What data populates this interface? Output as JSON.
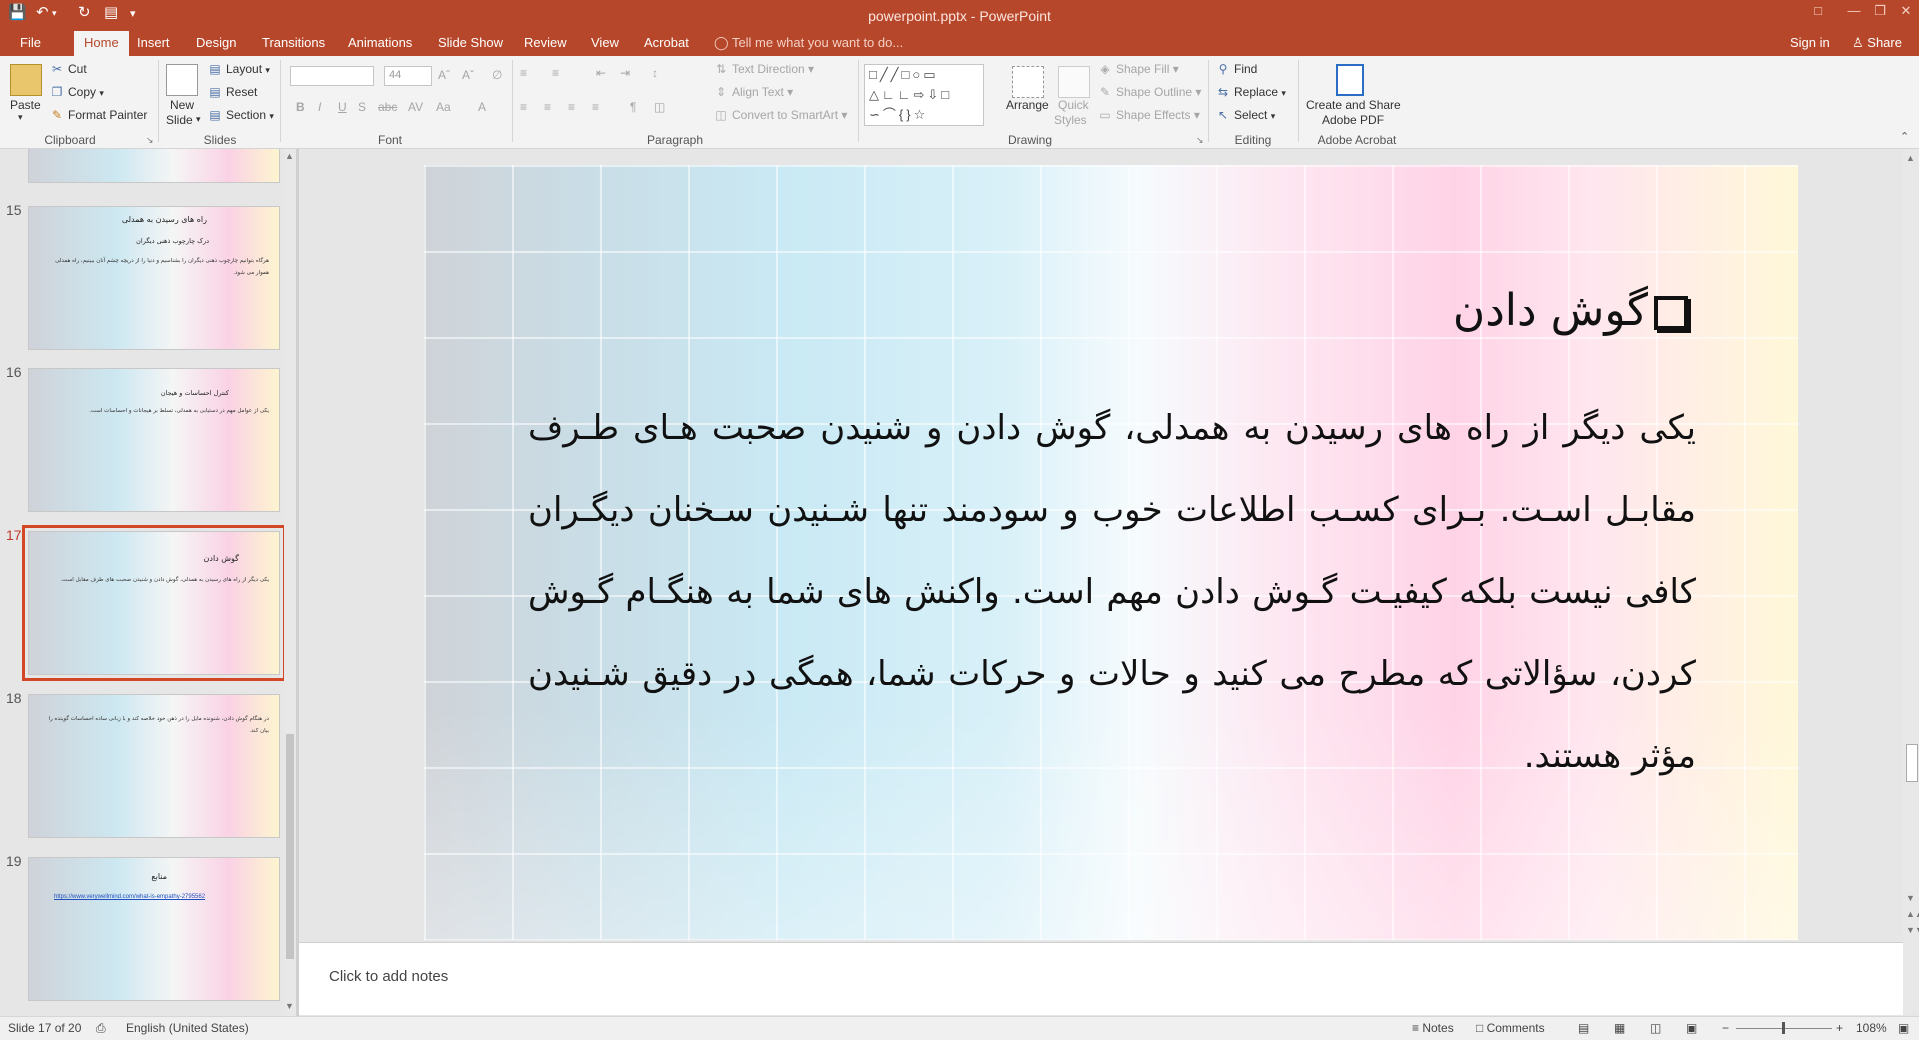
{
  "window": {
    "title": "powerpoint.pptx - PowerPoint"
  },
  "tabs": [
    {
      "label": "File"
    },
    {
      "label": "Home",
      "active": true
    },
    {
      "label": "Insert"
    },
    {
      "label": "Design"
    },
    {
      "label": "Transitions"
    },
    {
      "label": "Animations"
    },
    {
      "label": "Slide Show"
    },
    {
      "label": "Review"
    },
    {
      "label": "View"
    },
    {
      "label": "Acrobat"
    }
  ],
  "tell_me": "Tell me what you want to do...",
  "account": {
    "sign_in": "Sign in",
    "share": "Share"
  },
  "ribbon": {
    "clipboard": {
      "paste": "Paste",
      "cut": "Cut",
      "copy": "Copy",
      "format_painter": "Format Painter",
      "group": "Clipboard"
    },
    "slides": {
      "new_slide_1": "New",
      "new_slide_2": "Slide",
      "layout": "Layout",
      "reset": "Reset",
      "section": "Section",
      "group": "Slides"
    },
    "font": {
      "font_size": "44",
      "group": "Font"
    },
    "paragraph": {
      "text_direction": "Text Direction",
      "align_text": "Align Text",
      "convert_smartart": "Convert to SmartArt",
      "group": "Paragraph"
    },
    "drawing": {
      "arrange": "Arrange",
      "quick_styles_1": "Quick",
      "quick_styles_2": "Styles",
      "shape_fill": "Shape Fill",
      "shape_outline": "Shape Outline",
      "shape_effects": "Shape Effects",
      "group": "Drawing"
    },
    "editing": {
      "find": "Find",
      "replace": "Replace",
      "select": "Select",
      "group": "Editing"
    },
    "acrobat": {
      "create_share_1": "Create and Share",
      "create_share_2": "Adobe PDF",
      "group": "Adobe Acrobat"
    }
  },
  "thumbnails": [
    {
      "num": "15",
      "title": "راه های رسیدن به همدلی",
      "sub": "درک چارچوب ذهنی دیگران",
      "body": "هرگاه بتوانیم چارچوب ذهنی دیگران را بشناسیم و دنیا را از دریچه چشم آنان ببینیم، راه همدلی هموار می شود."
    },
    {
      "num": "16",
      "title": "",
      "sub": "کنترل احساسات و هیجان",
      "body": "یکی از عوامل مهم در دستیابی به همدلی، تسلط بر هیجانات و احساسات است."
    },
    {
      "num": "17",
      "title": "گوش دادن",
      "sub": "",
      "body": "یکی دیگر از راه های رسیدن به همدلی، گوش دادن و شنیدن صحبت های طرف مقابل است.",
      "selected": true
    },
    {
      "num": "18",
      "title": "",
      "sub": "",
      "body": "در هنگام گوش دادن، شنونده مایل را در ذهن خود خلاصه کند و با زبانی ساده احساسات گوینده را بیان کند."
    },
    {
      "num": "19",
      "title": "منابع",
      "sub": "",
      "body": "",
      "link": "https://www.verywellmind.com/what-is-empathy-2795562"
    }
  ],
  "slide": {
    "title": "گوش دادن",
    "body": "یکی دیگر از راه های رسیدن به همدلی، گوش دادن و شنیدن صحبت هـای طـرف مقابـل اسـت. بـرای کسـب اطلاعات خوب و سودمند تنها شـنیدن سـخنان دیگـران کافی نیست بلکه کیفیـت گـوش دادن مهم است. واکنش های شما به هنگـام گـوش کردن، سؤالاتی که مطرح می کنید و حالات و حرکات شما، همگی در دقیق شـنیدن مؤثر هستند."
  },
  "notes": {
    "placeholder": "Click to add notes"
  },
  "status": {
    "slide_counter": "Slide 17 of 20",
    "language": "English (United States)",
    "notes_btn": "Notes",
    "comments_btn": "Comments",
    "zoom": "108%"
  },
  "colors": {
    "accent": "#b7472a",
    "selected_thumb": "#d24726"
  }
}
